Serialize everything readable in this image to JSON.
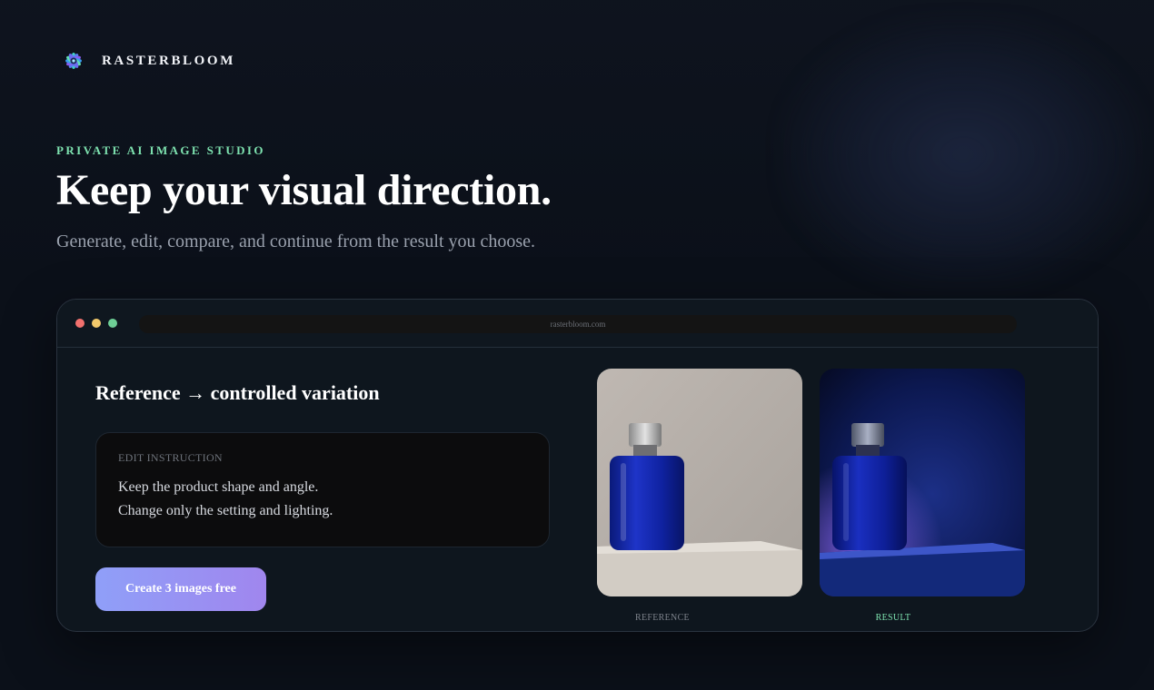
{
  "brand": {
    "name": "RASTERBLOOM",
    "logo_icon": "bloom-logo-icon"
  },
  "hero": {
    "eyebrow": "PRIVATE AI IMAGE STUDIO",
    "headline": "Keep your visual direction.",
    "subhead": "Generate, edit, compare, and continue from the result you choose."
  },
  "window": {
    "url": "rasterbloom.com",
    "panel_title": "Reference → controlled variation",
    "instruction": {
      "label": "EDIT INSTRUCTION",
      "lines": [
        "Keep the product shape and angle.",
        "Change only the setting and lighting."
      ]
    },
    "cta_label": "Create 3 images free",
    "images": {
      "reference_caption": "REFERENCE",
      "result_caption": "RESULT"
    }
  },
  "colors": {
    "accent_green": "#7ee3b0",
    "cta_start": "#8f9ff8",
    "cta_end": "#a086ee",
    "background": "#0b1019"
  }
}
